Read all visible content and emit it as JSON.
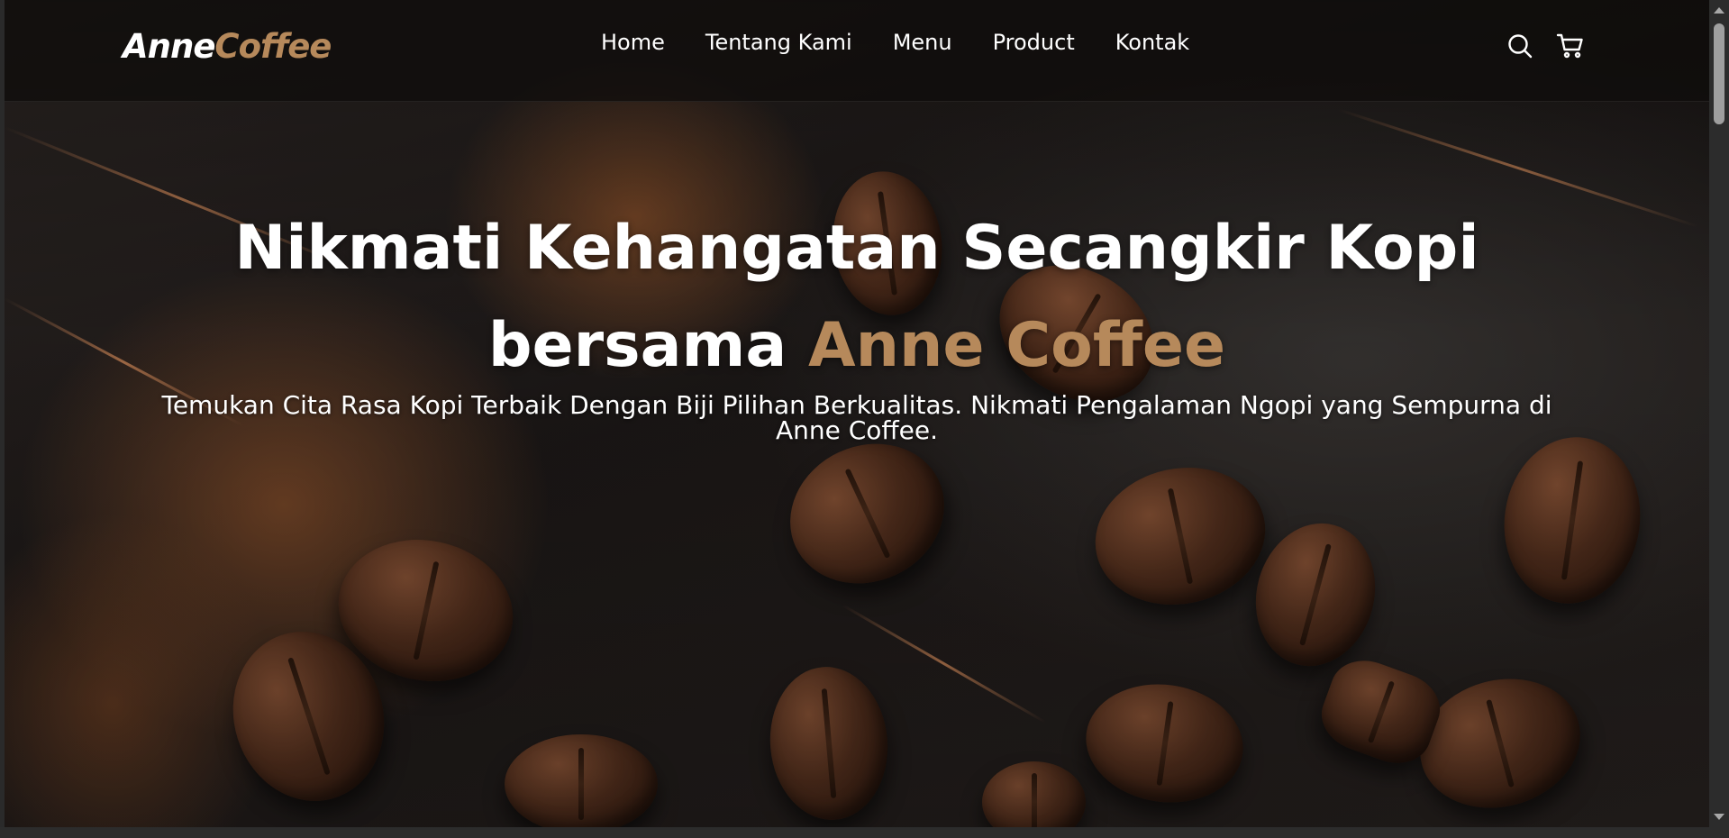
{
  "brand": {
    "logo_part1": "Anne",
    "logo_part2": "Coffee",
    "accent_color": "#b6895b"
  },
  "nav": {
    "items": [
      {
        "label": "Home"
      },
      {
        "label": "Tentang Kami"
      },
      {
        "label": "Menu"
      },
      {
        "label": "Product"
      },
      {
        "label": "Kontak"
      }
    ],
    "icons": [
      "search-icon",
      "shopping-cart-icon"
    ]
  },
  "hero": {
    "title_line1": "Nikmati Kehangatan Secangkir Kopi",
    "title_line2_prefix": "bersama",
    "title_line2_accent": "Anne Coffee",
    "subtitle": "Temukan Cita Rasa Kopi Terbaik Dengan Biji Pilihan Berkualitas. Nikmati Pengalaman Ngopi yang Sempurna di Anne Coffee."
  }
}
